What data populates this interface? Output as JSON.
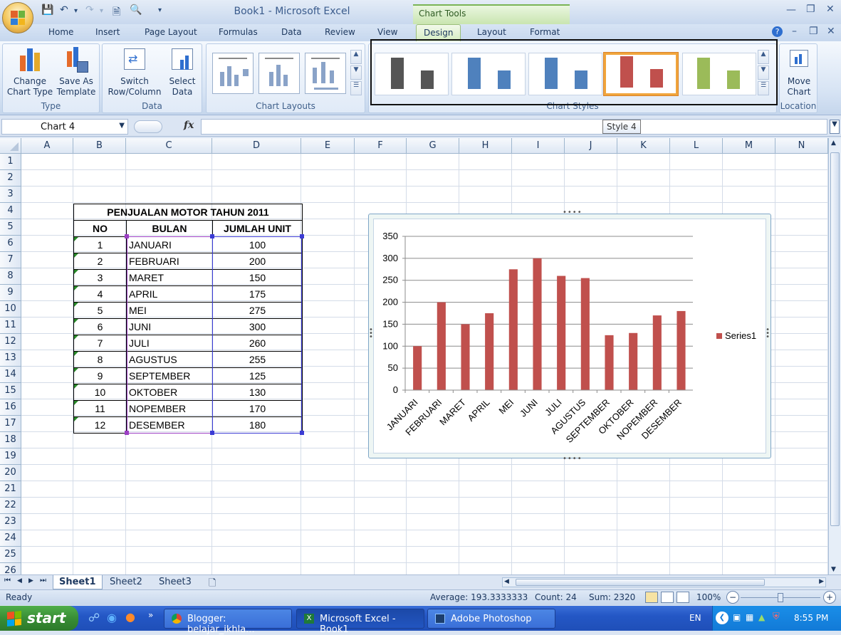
{
  "window": {
    "title": "Book1 - Microsoft Excel",
    "context_tab": "Chart Tools"
  },
  "tabs": [
    "Home",
    "Insert",
    "Page Layout",
    "Formulas",
    "Data",
    "Review",
    "View",
    "Design",
    "Layout",
    "Format"
  ],
  "active_tab": "Design",
  "ribbon": {
    "type_group": {
      "label": "Type",
      "change_chart_type": "Change\nChart Type",
      "save_as_template": "Save As\nTemplate"
    },
    "data_group": {
      "label": "Data",
      "switch_row_column": "Switch\nRow/Column",
      "select_data": "Select\nData"
    },
    "layouts_group": {
      "label": "Chart Layouts"
    },
    "styles_group": {
      "label": "Chart Styles"
    },
    "location_group": {
      "label": "Location",
      "move_chart": "Move\nChart"
    },
    "style_colors": [
      "#555555",
      "#4f81bd",
      "#4f81bd",
      "#c0504d",
      "#9bbb59"
    ],
    "selected_style_index": 3
  },
  "tooltip": "Style 4",
  "formula_bar": {
    "name_box": "Chart 4",
    "fx": "fx",
    "value": ""
  },
  "grid": {
    "columns": [
      "A",
      "B",
      "C",
      "D",
      "E",
      "F",
      "G",
      "H",
      "I",
      "J",
      "K",
      "L",
      "M",
      "N"
    ],
    "rows": [
      "1",
      "2",
      "3",
      "4",
      "5",
      "6",
      "7",
      "8",
      "9",
      "10",
      "11",
      "12",
      "13",
      "14",
      "15",
      "16",
      "17",
      "18",
      "19",
      "20",
      "21",
      "22",
      "23",
      "24",
      "25",
      "26"
    ]
  },
  "table": {
    "title": "PENJUALAN MOTOR TAHUN 2011",
    "headers": [
      "NO",
      "BULAN",
      "JUMLAH UNIT"
    ],
    "rows": [
      [
        "1",
        "JANUARI",
        "100"
      ],
      [
        "2",
        "FEBRUARI",
        "200"
      ],
      [
        "3",
        "MARET",
        "150"
      ],
      [
        "4",
        "APRIL",
        "175"
      ],
      [
        "5",
        "MEI",
        "275"
      ],
      [
        "6",
        "JUNI",
        "300"
      ],
      [
        "7",
        "JULI",
        "260"
      ],
      [
        "8",
        "AGUSTUS",
        "255"
      ],
      [
        "9",
        "SEPTEMBER",
        "125"
      ],
      [
        "10",
        "OKTOBER",
        "130"
      ],
      [
        "11",
        "NOPEMBER",
        "170"
      ],
      [
        "12",
        "DESEMBER",
        "180"
      ]
    ]
  },
  "chart_data": {
    "type": "bar",
    "categories": [
      "JANUARI",
      "FEBRUARI",
      "MARET",
      "APRIL",
      "MEI",
      "JUNI",
      "JULI",
      "AGUSTUS",
      "SEPTEMBER",
      "OKTOBER",
      "NOPEMBER",
      "DESEMBER"
    ],
    "series": [
      {
        "name": "Series1",
        "values": [
          100,
          200,
          150,
          175,
          275,
          300,
          260,
          255,
          125,
          130,
          170,
          180
        ],
        "color": "#c0504d"
      }
    ],
    "y_ticks": [
      "0",
      "50",
      "100",
      "150",
      "200",
      "250",
      "300",
      "350"
    ],
    "ylim": [
      0,
      350
    ],
    "title": "",
    "xlabel": "",
    "ylabel": "",
    "grid": true,
    "legend": "right"
  },
  "sheet_tabs": [
    "Sheet1",
    "Sheet2",
    "Sheet3"
  ],
  "active_sheet": "Sheet1",
  "status": {
    "mode": "Ready",
    "average": "Average: 193.3333333",
    "count": "Count: 24",
    "sum": "Sum: 2320",
    "zoom": "100%"
  },
  "taskbar": {
    "start": "start",
    "tasks": [
      "Blogger: belajar_ikhla...",
      "Microsoft Excel - Book1",
      "Adobe Photoshop"
    ],
    "active_task": "Microsoft Excel - Book1",
    "lang": "EN",
    "clock": "8:55 PM"
  }
}
